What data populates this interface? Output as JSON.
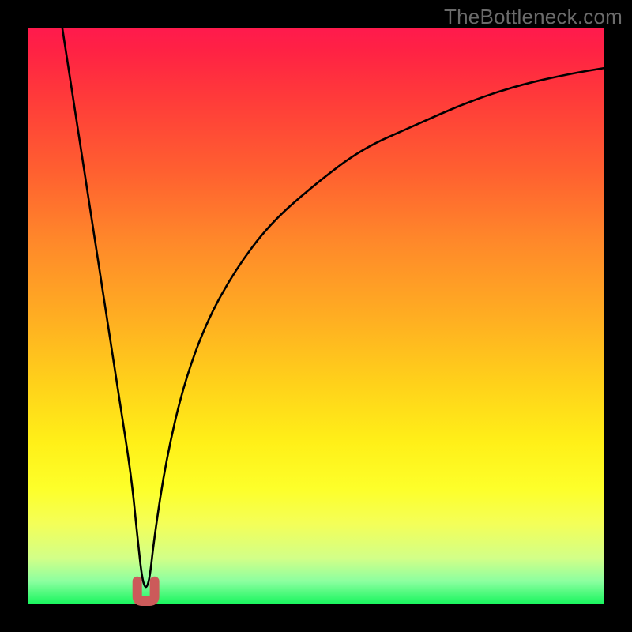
{
  "attribution": "TheBottleneck.com",
  "chart_data": {
    "type": "line",
    "title": "",
    "xlabel": "",
    "ylabel": "",
    "xlim": [
      0,
      100
    ],
    "ylim": [
      0,
      100
    ],
    "series": [
      {
        "name": "bottleneck-curve",
        "x": [
          6,
          8,
          10,
          12,
          14,
          16,
          18,
          19,
          20,
          21,
          22,
          24,
          27,
          31,
          36,
          42,
          50,
          58,
          67,
          76,
          85,
          94,
          100
        ],
        "y": [
          100,
          87,
          74,
          61,
          48,
          35,
          22,
          12,
          3,
          3,
          12,
          25,
          38,
          49,
          58,
          66,
          73,
          79,
          83,
          87,
          90,
          92,
          93
        ]
      }
    ],
    "marker": {
      "name": "optimal-u-marker",
      "x_center": 20.5,
      "width": 3,
      "height": 4,
      "color": "#cc5a5a"
    },
    "grid": false,
    "legend": false
  }
}
